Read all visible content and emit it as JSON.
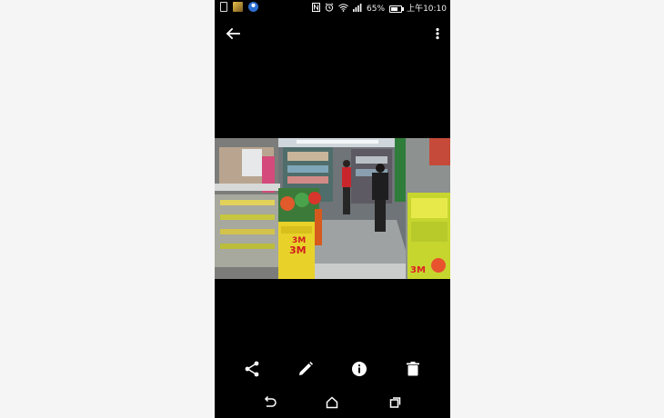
{
  "status_bar": {
    "notification_icons": [
      "sim-card-icon",
      "image-app-icon",
      "map-pin-app-icon"
    ],
    "system_icons": [
      "nfc-icon",
      "alarm-icon",
      "wifi-icon",
      "signal-icon"
    ],
    "battery_percent": "65%",
    "time": "上午10:10",
    "colors": {
      "background": "#000000",
      "text": "#ffffff"
    }
  },
  "top_bar": {
    "back_icon": "arrow-back-icon",
    "more_icon": "more-vert-icon"
  },
  "photo": {
    "description_icon": "photo-content",
    "visible_text": [
      "3M",
      "3M",
      "3M"
    ]
  },
  "actions": [
    {
      "icon": "share-icon"
    },
    {
      "icon": "edit-icon"
    },
    {
      "icon": "info-icon"
    },
    {
      "icon": "delete-icon"
    }
  ],
  "nav_bar": [
    {
      "icon": "nav-back-icon"
    },
    {
      "icon": "nav-home-icon"
    },
    {
      "icon": "nav-recents-icon"
    }
  ],
  "colors": {
    "page": "#f5f5f5",
    "screen": "#000000",
    "icon": "#ffffff"
  }
}
